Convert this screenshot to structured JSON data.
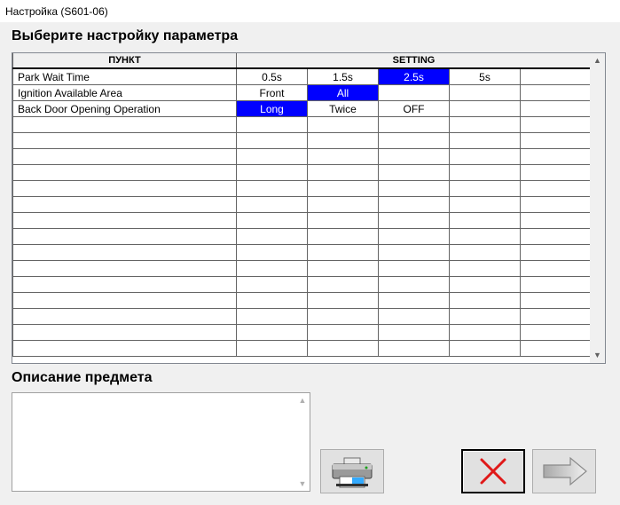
{
  "window": {
    "title": "Настройка (S601-06)"
  },
  "heading": "Выберите настройку параметра",
  "table": {
    "columns": {
      "item": "ПУНКТ",
      "setting": "SETTING"
    },
    "rows": [
      {
        "item": "Park Wait Time",
        "options": [
          "0.5s",
          "1.5s",
          "2.5s",
          "5s",
          ""
        ],
        "selected": 2
      },
      {
        "item": "Ignition Available Area",
        "options": [
          "Front",
          "All",
          "",
          "",
          ""
        ],
        "selected": 1
      },
      {
        "item": "Back Door Opening Operation",
        "options": [
          "Long",
          "Twice",
          "OFF",
          "",
          ""
        ],
        "selected": 0
      }
    ],
    "empty_row_count": 15
  },
  "description": {
    "label": "Описание предмета",
    "value": ""
  },
  "buttons": {
    "print": {
      "icon": "printer-icon"
    },
    "cancel": {
      "icon": "red-x-icon"
    },
    "next": {
      "icon": "arrow-right-icon"
    }
  },
  "colors": {
    "selected_bg": "#0000ff",
    "selected_fg": "#ffffff",
    "cancel_x": "#e01818"
  }
}
